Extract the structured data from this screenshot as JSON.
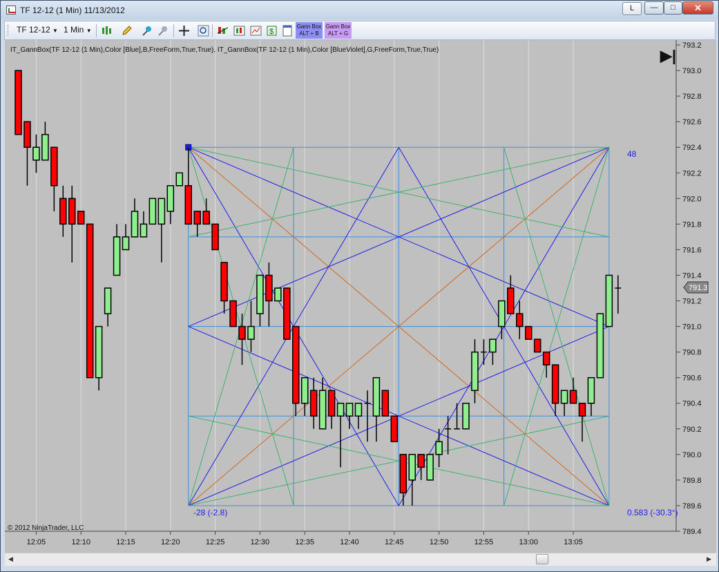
{
  "window": {
    "title": "TF 12-12 (1 Min)  11/13/2012",
    "link_button": "L",
    "minimize_glyph": "—",
    "maximize_glyph": "□",
    "close_glyph": "✕"
  },
  "toolbar": {
    "instrument": "TF 12-12",
    "interval": "1 Min",
    "gann_box_b": [
      "Gann Box",
      "ALT + B"
    ],
    "gann_box_g": [
      "Gann Box",
      "ALT + G"
    ],
    "icons": [
      "bar-type-icon",
      "drawing-pencil-icon",
      "zoom-in-icon",
      "zoom-out-icon",
      "crosshair-icon",
      "zoom-magnifier-icon",
      "indicators-icon",
      "strategies-icon",
      "chart-properties-icon",
      "dollar-icon",
      "data-box-icon"
    ]
  },
  "chart": {
    "indicator_label": "IT_GannBox(TF 12-12 (1 Min),Color [Blue],B,FreeForm,True,True),  IT_GannBox(TF 12-12 (1 Min),Color [BlueViolet],G,FreeForm,True,True)",
    "copyright": "© 2012 NinjaTrader, LLC",
    "last_price_marker": "791.3",
    "go_to_end_glyph": "▶|",
    "up_color": "#90ee90",
    "down_color": "#ff0000",
    "background_color": "#c0c0c0",
    "gann_colors": {
      "frame": "#3d8ee3",
      "diagonal": "#d2691e",
      "fan": "#1e1ee6",
      "fan_green": "#3cb371"
    },
    "box_labels": {
      "top_right": "48",
      "bottom_left": "-28 (-2.8)",
      "bottom_right": "0.583 (-30.3°)"
    }
  },
  "chart_data": {
    "type": "candlestick",
    "title": "TF 12-12 (1 Min)",
    "date": "11/13/2012",
    "xlabel": "",
    "ylabel": "",
    "x_ticks": [
      "12:05",
      "12:10",
      "12:15",
      "12:20",
      "12:25",
      "12:30",
      "12:35",
      "12:40",
      "12:45",
      "12:50",
      "12:55",
      "13:00",
      "13:05"
    ],
    "y_ticks": [
      "793.2",
      "793.0",
      "792.8",
      "792.6",
      "792.4",
      "792.2",
      "792.0",
      "791.8",
      "791.6",
      "791.4",
      "791.2",
      "791.0",
      "790.8",
      "790.6",
      "790.4",
      "790.2",
      "790.0",
      "789.8",
      "789.6",
      "789.4"
    ],
    "ylim": [
      789.4,
      793.2
    ],
    "gridlines": "vertical",
    "candles": [
      {
        "time": "12:03",
        "open": 793.0,
        "high": 793.0,
        "low": 792.5,
        "close": 792.5
      },
      {
        "time": "12:04",
        "open": 792.6,
        "high": 792.6,
        "low": 792.1,
        "close": 792.4
      },
      {
        "time": "12:05",
        "open": 792.3,
        "high": 792.5,
        "low": 792.2,
        "close": 792.4
      },
      {
        "time": "12:06",
        "open": 792.3,
        "high": 792.6,
        "low": 792.3,
        "close": 792.5
      },
      {
        "time": "12:07",
        "open": 792.4,
        "high": 792.4,
        "low": 791.9,
        "close": 792.1
      },
      {
        "time": "12:08",
        "open": 792.0,
        "high": 792.1,
        "low": 791.7,
        "close": 791.8
      },
      {
        "time": "12:09",
        "open": 792.0,
        "high": 792.1,
        "low": 791.5,
        "close": 791.8
      },
      {
        "time": "12:10",
        "open": 791.9,
        "high": 791.9,
        "low": 791.8,
        "close": 791.8
      },
      {
        "time": "12:11",
        "open": 791.8,
        "high": 791.8,
        "low": 790.6,
        "close": 790.6
      },
      {
        "time": "12:12",
        "open": 790.6,
        "high": 791.0,
        "low": 790.5,
        "close": 791.0
      },
      {
        "time": "12:13",
        "open": 791.1,
        "high": 791.3,
        "low": 791.0,
        "close": 791.3
      },
      {
        "time": "12:14",
        "open": 791.4,
        "high": 791.8,
        "low": 791.4,
        "close": 791.7
      },
      {
        "time": "12:15",
        "open": 791.6,
        "high": 791.8,
        "low": 791.6,
        "close": 791.7
      },
      {
        "time": "12:16",
        "open": 791.7,
        "high": 792.0,
        "low": 791.7,
        "close": 791.9
      },
      {
        "time": "12:17",
        "open": 791.7,
        "high": 791.9,
        "low": 791.7,
        "close": 791.8
      },
      {
        "time": "12:18",
        "open": 791.8,
        "high": 792.0,
        "low": 791.8,
        "close": 792.0
      },
      {
        "time": "12:19",
        "open": 791.8,
        "high": 792.0,
        "low": 791.5,
        "close": 792.0
      },
      {
        "time": "12:20",
        "open": 791.9,
        "high": 792.1,
        "low": 791.8,
        "close": 792.1
      },
      {
        "time": "12:21",
        "open": 792.1,
        "high": 792.2,
        "low": 792.1,
        "close": 792.2
      },
      {
        "time": "12:22",
        "open": 792.1,
        "high": 792.4,
        "low": 791.8,
        "close": 791.8
      },
      {
        "time": "12:23",
        "open": 791.9,
        "high": 791.9,
        "low": 791.7,
        "close": 791.8
      },
      {
        "time": "12:24",
        "open": 791.9,
        "high": 792.0,
        "low": 791.8,
        "close": 791.8
      },
      {
        "time": "12:25",
        "open": 791.8,
        "high": 791.8,
        "low": 791.6,
        "close": 791.6
      },
      {
        "time": "12:26",
        "open": 791.5,
        "high": 791.5,
        "low": 791.1,
        "close": 791.2
      },
      {
        "time": "12:27",
        "open": 791.2,
        "high": 791.2,
        "low": 791.0,
        "close": 791.0
      },
      {
        "time": "12:28",
        "open": 791.0,
        "high": 791.1,
        "low": 790.7,
        "close": 790.9
      },
      {
        "time": "12:29",
        "open": 790.9,
        "high": 791.2,
        "low": 790.8,
        "close": 791.0
      },
      {
        "time": "12:30",
        "open": 791.1,
        "high": 791.4,
        "low": 791.0,
        "close": 791.4
      },
      {
        "time": "12:31",
        "open": 791.4,
        "high": 791.5,
        "low": 791.0,
        "close": 791.2
      },
      {
        "time": "12:32",
        "open": 791.2,
        "high": 791.3,
        "low": 791.2,
        "close": 791.3
      },
      {
        "time": "12:33",
        "open": 791.3,
        "high": 791.3,
        "low": 790.9,
        "close": 790.9
      },
      {
        "time": "12:34",
        "open": 791.0,
        "high": 791.0,
        "low": 790.3,
        "close": 790.4
      },
      {
        "time": "12:35",
        "open": 790.4,
        "high": 790.6,
        "low": 790.3,
        "close": 790.6
      },
      {
        "time": "12:36",
        "open": 790.5,
        "high": 790.6,
        "low": 790.2,
        "close": 790.3
      },
      {
        "time": "12:37",
        "open": 790.2,
        "high": 790.6,
        "low": 790.2,
        "close": 790.5
      },
      {
        "time": "12:38",
        "open": 790.5,
        "high": 790.5,
        "low": 790.2,
        "close": 790.3
      },
      {
        "time": "12:39",
        "open": 790.3,
        "high": 790.4,
        "low": 789.9,
        "close": 790.4
      },
      {
        "time": "12:40",
        "open": 790.3,
        "high": 790.4,
        "low": 790.2,
        "close": 790.4
      },
      {
        "time": "12:41",
        "open": 790.3,
        "high": 790.4,
        "low": 790.2,
        "close": 790.4
      },
      {
        "time": "12:42",
        "open": 790.4,
        "high": 790.5,
        "low": 790.1,
        "close": 790.4
      },
      {
        "time": "12:43",
        "open": 790.3,
        "high": 790.6,
        "low": 790.1,
        "close": 790.6
      },
      {
        "time": "12:44",
        "open": 790.5,
        "high": 790.5,
        "low": 790.3,
        "close": 790.3
      },
      {
        "time": "12:45",
        "open": 790.3,
        "high": 790.3,
        "low": 790.1,
        "close": 790.1
      },
      {
        "time": "12:46",
        "open": 790.0,
        "high": 790.0,
        "low": 789.6,
        "close": 789.7
      },
      {
        "time": "12:47",
        "open": 789.8,
        "high": 790.0,
        "low": 789.6,
        "close": 790.0
      },
      {
        "time": "12:48",
        "open": 790.0,
        "high": 790.0,
        "low": 789.8,
        "close": 789.9
      },
      {
        "time": "12:49",
        "open": 789.8,
        "high": 790.0,
        "low": 789.8,
        "close": 790.0
      },
      {
        "time": "12:50",
        "open": 790.0,
        "high": 790.2,
        "low": 789.9,
        "close": 790.1
      },
      {
        "time": "12:51",
        "open": 790.2,
        "high": 790.3,
        "low": 790.0,
        "close": 790.2
      },
      {
        "time": "12:52",
        "open": 790.2,
        "high": 790.4,
        "low": 790.2,
        "close": 790.2
      },
      {
        "time": "12:53",
        "open": 790.2,
        "high": 790.4,
        "low": 790.2,
        "close": 790.4
      },
      {
        "time": "12:54",
        "open": 790.5,
        "high": 790.9,
        "low": 790.4,
        "close": 790.8
      },
      {
        "time": "12:55",
        "open": 790.8,
        "high": 790.9,
        "low": 790.7,
        "close": 790.8
      },
      {
        "time": "12:56",
        "open": 790.8,
        "high": 790.9,
        "low": 790.7,
        "close": 790.9
      },
      {
        "time": "12:57",
        "open": 791.0,
        "high": 791.2,
        "low": 790.9,
        "close": 791.2
      },
      {
        "time": "12:58",
        "open": 791.3,
        "high": 791.4,
        "low": 791.1,
        "close": 791.1
      },
      {
        "time": "12:59",
        "open": 791.1,
        "high": 791.2,
        "low": 790.9,
        "close": 791.0
      },
      {
        "time": "13:00",
        "open": 791.0,
        "high": 791.0,
        "low": 790.9,
        "close": 790.9
      },
      {
        "time": "13:01",
        "open": 790.9,
        "high": 790.9,
        "low": 790.8,
        "close": 790.8
      },
      {
        "time": "13:02",
        "open": 790.8,
        "high": 790.8,
        "low": 790.6,
        "close": 790.7
      },
      {
        "time": "13:03",
        "open": 790.7,
        "high": 790.7,
        "low": 790.3,
        "close": 790.4
      },
      {
        "time": "13:04",
        "open": 790.4,
        "high": 790.5,
        "low": 790.3,
        "close": 790.5
      },
      {
        "time": "13:05",
        "open": 790.5,
        "high": 790.6,
        "low": 790.4,
        "close": 790.4
      },
      {
        "time": "13:06",
        "open": 790.4,
        "high": 790.4,
        "low": 790.1,
        "close": 790.3
      },
      {
        "time": "13:07",
        "open": 790.4,
        "high": 790.6,
        "low": 790.3,
        "close": 790.6
      },
      {
        "time": "13:08",
        "open": 790.6,
        "high": 791.1,
        "low": 790.6,
        "close": 791.1
      },
      {
        "time": "13:09",
        "open": 791.0,
        "high": 791.4,
        "low": 791.0,
        "close": 791.4
      },
      {
        "time": "13:10",
        "open": 791.3,
        "high": 791.4,
        "low": 791.1,
        "close": 791.3
      }
    ],
    "gann_box": {
      "start_time": "12:22",
      "end_time": "13:09",
      "top": 792.4,
      "bottom": 789.6
    }
  }
}
